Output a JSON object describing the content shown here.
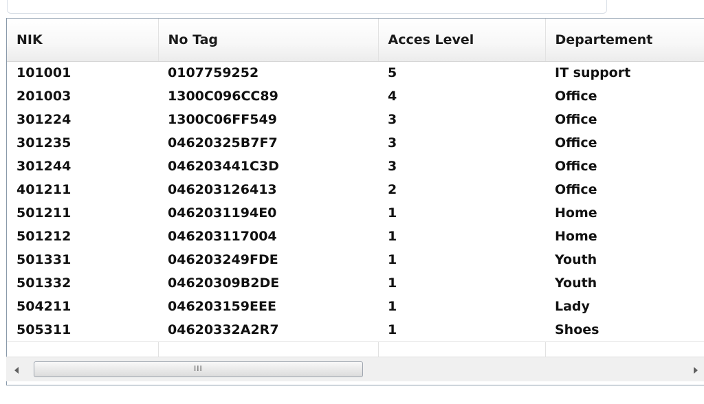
{
  "table": {
    "columns": [
      "NIK",
      "No Tag",
      "Acces Level",
      "Departement"
    ],
    "rows": [
      [
        "101001",
        "0107759252",
        "5",
        "IT support"
      ],
      [
        "201003",
        "1300C096CC89",
        "4",
        "Office"
      ],
      [
        "301224",
        "1300C06FF549",
        "3",
        "Office"
      ],
      [
        "301235",
        "04620325B7F7",
        "3",
        "Office"
      ],
      [
        "301244",
        "046203441C3D",
        "3",
        "Office"
      ],
      [
        "401211",
        "046203126413",
        "2",
        "Office"
      ],
      [
        "501211",
        "0462031194E0",
        "1",
        "Home"
      ],
      [
        "501212",
        "046203117004",
        "1",
        "Home"
      ],
      [
        "501331",
        "046203249FDE",
        "1",
        "Youth"
      ],
      [
        "501332",
        "04620309B2DE",
        "1",
        "Youth"
      ],
      [
        "504211",
        "046203159EEE",
        "1",
        "Lady"
      ],
      [
        "505311",
        "04620332A2R7",
        "1",
        "Shoes"
      ]
    ]
  },
  "scrollbar": {
    "grip_text": "III",
    "left_arrow_icon": "arrow-left-icon",
    "right_arrow_icon": "arrow-right-icon"
  }
}
